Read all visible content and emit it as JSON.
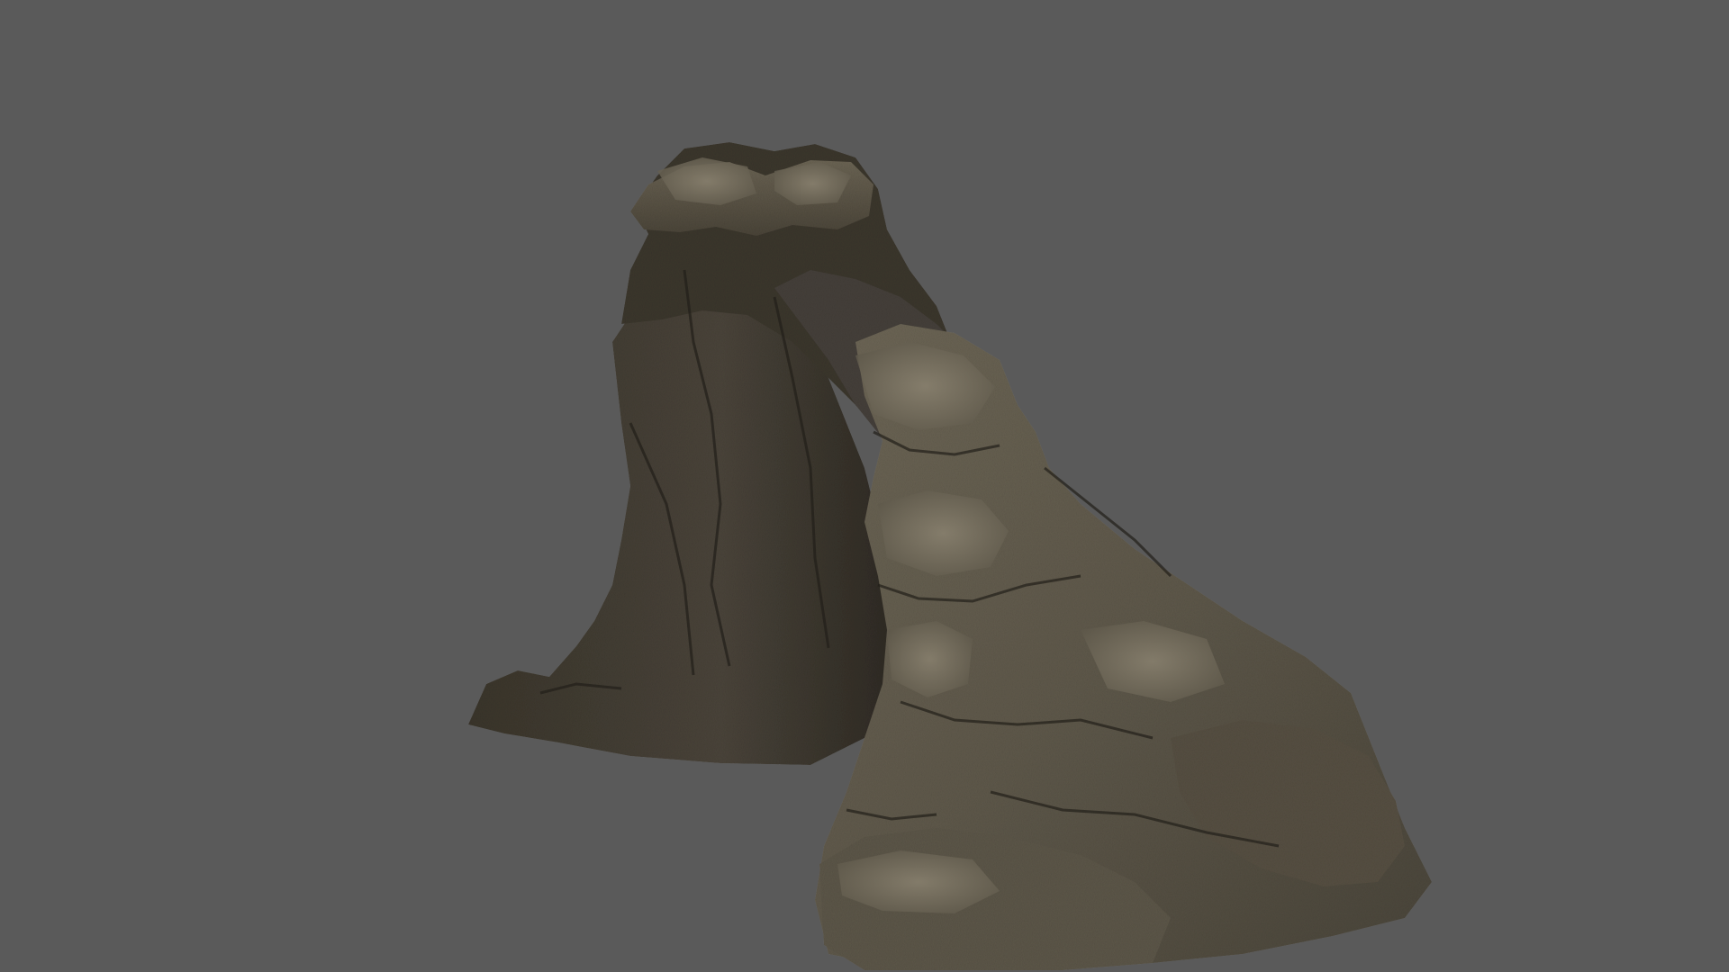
{
  "scene": {
    "subject": "rock-formation",
    "background_color": "#5a5a5a",
    "rock_colors": {
      "shadow": "#2e2a22",
      "mid": "#4f4a3e",
      "light": "#77705f",
      "highlight": "#948c79"
    }
  }
}
